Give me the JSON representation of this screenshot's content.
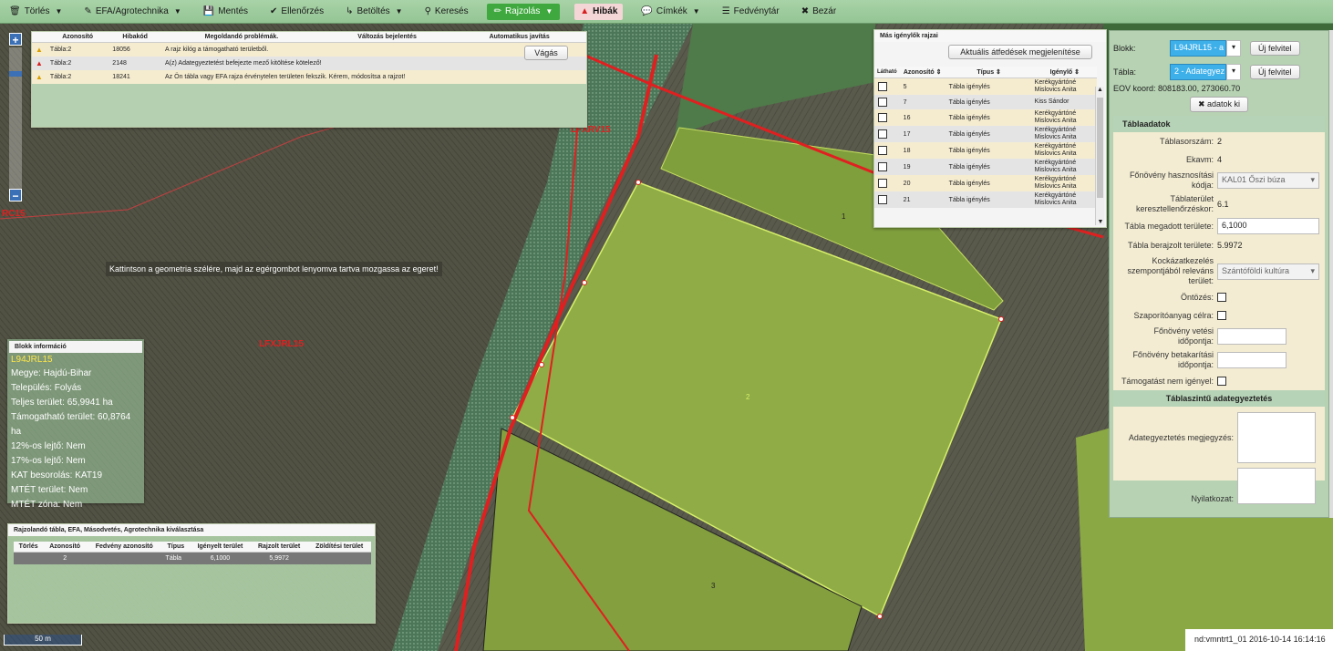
{
  "toolbar": {
    "items": [
      {
        "icon": "🗑",
        "label": "Törlés",
        "caret": true
      },
      {
        "icon": "✎",
        "label": "EFA/Agrotechnika",
        "caret": true
      },
      {
        "icon": "💾",
        "label": "Mentés",
        "caret": false
      },
      {
        "icon": "✔",
        "label": "Ellenőrzés",
        "caret": false
      },
      {
        "icon": "↳",
        "label": "Betöltés",
        "caret": true
      },
      {
        "icon": "⚲",
        "label": "Keresés",
        "caret": false
      },
      {
        "icon": "✏",
        "label": "Rajzolás",
        "caret": true
      },
      {
        "icon": "▲",
        "label": "Hibák",
        "caret": false
      },
      {
        "icon": "💬",
        "label": "Címkék",
        "caret": true
      },
      {
        "icon": "☰",
        "label": "Fedvénytár",
        "caret": false
      },
      {
        "icon": "✖",
        "label": "Bezár",
        "caret": false
      }
    ]
  },
  "errors": {
    "headers": [
      "Azonosító",
      "Hibakód",
      "Megoldandó problémák.",
      "Változás bejelentés",
      "Automatikus javítás"
    ],
    "rows": [
      {
        "level": "warning",
        "id": "Tábla:2",
        "code": "18056",
        "text": "A rajz kilóg a támogatható területből."
      },
      {
        "level": "error",
        "id": "Tábla:2",
        "code": "2148",
        "text": "A(z) Adategyeztetést befejezte mező kitöltése kötelező!"
      },
      {
        "level": "warning",
        "id": "Tábla:2",
        "code": "18241",
        "text": "Az Ön tábla vagy EFA rajza érvénytelen területen fekszik. Kérem, módosítsa a rajzot!"
      }
    ],
    "fix_button": "Vágás"
  },
  "hint": "Kattintson a geometria szélére, majd az egérgombot lenyomva tartva mozgassa az egeret!",
  "map_labels": {
    "lfxjrl": "LFXJRL15",
    "lfxrv": "LFXRV15",
    "rc15": "RC15",
    "p1": "1",
    "p2": "2",
    "p3": "3"
  },
  "others": {
    "title": "Más igénylők rajzai",
    "button": "Aktuális átfedések megjelenítése",
    "headers": [
      "Látható",
      "Azonosító",
      "Típus",
      "Igénylő"
    ],
    "rows": [
      {
        "id": "5",
        "type": "Tábla igénylés",
        "owner": "Kerékgyártóné Mislovics Anita"
      },
      {
        "id": "7",
        "type": "Tábla igénylés",
        "owner": "Kiss Sándor"
      },
      {
        "id": "16",
        "type": "Tábla igénylés",
        "owner": "Kerékgyártóné Mislovics Anita"
      },
      {
        "id": "17",
        "type": "Tábla igénylés",
        "owner": "Kerékgyártóné Mislovics Anita"
      },
      {
        "id": "18",
        "type": "Tábla igénylés",
        "owner": "Kerékgyártóné Mislovics Anita"
      },
      {
        "id": "19",
        "type": "Tábla igénylés",
        "owner": "Kerékgyártóné Mislovics Anita"
      },
      {
        "id": "20",
        "type": "Tábla igénylés",
        "owner": "Kerékgyártóné Mislovics Anita"
      },
      {
        "id": "21",
        "type": "Tábla igénylés",
        "owner": "Kerékgyártóné Mislovics Anita"
      }
    ]
  },
  "block_info": {
    "title": "Blokk információ",
    "code": "L94JRL15",
    "lines": [
      "Megye: Hajdú-Bihar",
      "Település: Folyás",
      "Teljes terület: 65,9941 ha",
      "Támogatható terület: 60,8764 ha",
      "12%-os lejtő: Nem",
      "17%-os lejtő: Nem",
      "KAT besorolás: KAT19",
      "MTÉT terület: Nem",
      "MTÉT zóna: Nem"
    ]
  },
  "draw_select": {
    "title": "Rajzolandó tábla, EFA, Másodvetés, Agrotechnika kiválasztása",
    "headers": [
      "Törlés",
      "Azonosító",
      "Fedvény azonosító",
      "Típus",
      "Igényelt terület",
      "Rajzolt terület",
      "Zöldítési terület"
    ],
    "row": {
      "id": "2",
      "type": "Tábla",
      "req": "6,1000",
      "drawn": "5,9972",
      "green": ""
    }
  },
  "side": {
    "blokk_label": "Blokk:",
    "blokk_value": "L94JRL15 - a",
    "tabla_label": "Tábla:",
    "tabla_value": "2 - Adategyez",
    "new_btn": "Új felvitel",
    "eov_label": "EOV koord:",
    "eov_value": "808183.00, 273060.70",
    "data_off": "adatok ki",
    "section1": "Táblaadatok",
    "fields": [
      {
        "label": "Táblasorszám:",
        "value": "2",
        "kind": "text"
      },
      {
        "label": "Ekavm:",
        "value": "4",
        "kind": "text"
      },
      {
        "label": "Főnövény hasznosítási kódja:",
        "value": "KAL01 Őszi búza",
        "kind": "select"
      },
      {
        "label": "Táblaterület keresztellenőrzéskor:",
        "value": "6.1",
        "kind": "text"
      },
      {
        "label": "Tábla megadott területe:",
        "value": "6,1000",
        "kind": "input"
      },
      {
        "label": "Tábla berajzolt területe:",
        "value": "5.9972",
        "kind": "text"
      },
      {
        "label": "Kockázatkezelés szempontjából releváns terület:",
        "value": "Szántóföldi kultúra",
        "kind": "select"
      },
      {
        "label": "Öntözés:",
        "value": "",
        "kind": "check"
      },
      {
        "label": "Szaporítóanyag célra:",
        "value": "",
        "kind": "check"
      },
      {
        "label": "Főnövény vetési időpontja:",
        "value": "",
        "kind": "input"
      },
      {
        "label": "Főnövény betakarítási időpontja:",
        "value": "",
        "kind": "input"
      },
      {
        "label": "Támogatást nem igényel:",
        "value": "",
        "kind": "check"
      }
    ],
    "section2": "Táblaszintű adategyeztetés",
    "note_label": "Adategyeztetés megjegyzés:",
    "decl_label": "Nyilatkozat:"
  },
  "status": "nd:vmntrt1_01  2016-10-14 16:14:16",
  "scale": "50 m"
}
